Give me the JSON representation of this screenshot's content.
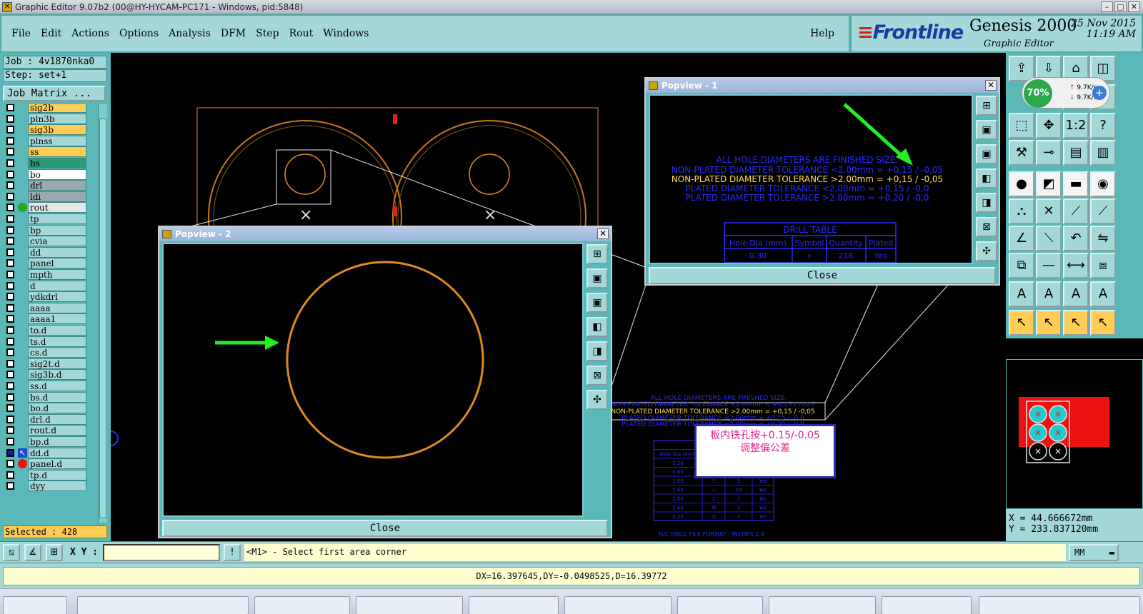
{
  "window": {
    "title": "Graphic Editor 9.07b2 (00@HY-HYCAM-PC171 - Windows, pid:5848)"
  },
  "menu": [
    "File",
    "Edit",
    "Actions",
    "Options",
    "Analysis",
    "DFM",
    "Step",
    "Rout",
    "Windows"
  ],
  "help": "Help",
  "brand": {
    "logo": "Frontline",
    "product": "Genesis 2000",
    "subtitle": "Graphic Editor",
    "date": "25 Nov 2015",
    "time": "11:19 AM"
  },
  "job": {
    "job": "Job : 4v1870nka0",
    "step": "Step: set+1",
    "matrix_button": "Job Matrix ..."
  },
  "layers": [
    {
      "name": "sig2b",
      "bg": "#ffcc55",
      "dot": ""
    },
    {
      "name": "pln3b",
      "bg": "#a4d8d8",
      "dot": ""
    },
    {
      "name": "sig3b",
      "bg": "#ffcc55",
      "dot": ""
    },
    {
      "name": "plnss",
      "bg": "#a4d8d8",
      "dot": ""
    },
    {
      "name": "ss",
      "bg": "#ffcc55",
      "dot": ""
    },
    {
      "name": "bs",
      "bg": "#2a9a7a",
      "dot": ""
    },
    {
      "name": "bo",
      "bg": "#ffffff",
      "dot": ""
    },
    {
      "name": "drl",
      "bg": "#9aa8b0",
      "dot": ""
    },
    {
      "name": "ldi",
      "bg": "#9aa8b0",
      "dot": ""
    },
    {
      "name": "rout",
      "bg": "#e6e6e6",
      "dot": "#22aa22"
    },
    {
      "name": "tp",
      "bg": "#a4d8d8",
      "dot": ""
    },
    {
      "name": "bp",
      "bg": "#a4d8d8",
      "dot": ""
    },
    {
      "name": "cvia",
      "bg": "#a4d8d8",
      "dot": ""
    },
    {
      "name": "dd",
      "bg": "#a4d8d8",
      "dot": ""
    },
    {
      "name": "panel",
      "bg": "#a4d8d8",
      "dot": ""
    },
    {
      "name": "mpth",
      "bg": "#a4d8d8",
      "dot": ""
    },
    {
      "name": "d",
      "bg": "#a4d8d8",
      "dot": ""
    },
    {
      "name": "ydkdrl",
      "bg": "#a4d8d8",
      "dot": ""
    },
    {
      "name": "aaaa",
      "bg": "#a4d8d8",
      "dot": ""
    },
    {
      "name": "aaaa1",
      "bg": "#a4d8d8",
      "dot": ""
    },
    {
      "name": "to.d",
      "bg": "#a4d8d8",
      "dot": ""
    },
    {
      "name": "ts.d",
      "bg": "#a4d8d8",
      "dot": ""
    },
    {
      "name": "cs.d",
      "bg": "#a4d8d8",
      "dot": ""
    },
    {
      "name": "sig2t.d",
      "bg": "#a4d8d8",
      "dot": ""
    },
    {
      "name": "sig3b.d",
      "bg": "#a4d8d8",
      "dot": ""
    },
    {
      "name": "ss.d",
      "bg": "#a4d8d8",
      "dot": ""
    },
    {
      "name": "bs.d",
      "bg": "#a4d8d8",
      "dot": ""
    },
    {
      "name": "bo.d",
      "bg": "#a4d8d8",
      "dot": ""
    },
    {
      "name": "drl.d",
      "bg": "#a4d8d8",
      "dot": ""
    },
    {
      "name": "rout.d",
      "bg": "#a4d8d8",
      "dot": ""
    },
    {
      "name": "bp.d",
      "bg": "#a4d8d8",
      "dot": ""
    },
    {
      "name": "dd.d",
      "bg": "#a4d8d8",
      "dot": "arrow"
    },
    {
      "name": "panel.d",
      "bg": "#a4d8d8",
      "dot": "#ee1111"
    },
    {
      "name": "tp.d",
      "bg": "#a4d8d8",
      "dot": ""
    },
    {
      "name": "dyy",
      "bg": "#a4d8d8",
      "dot": ""
    }
  ],
  "selected": "Selected : 428",
  "popview1": {
    "title": "Popview - 1",
    "close": "Close"
  },
  "popview2": {
    "title": "Popview - 2",
    "close": "Close"
  },
  "notes": {
    "line1": "ALL HOLE DIAMETERS ARE FINISHED SIZE.",
    "line2": "NON-PLATED DIAMETER TOLERANCE <2.00mm = +0,15 / -0,05",
    "line3": "NON-PLATED DIAMETER TOLERANCE >2.00mm = +0,15 / -0,05",
    "line4": "PLATED DIAMETER TOLERANCE <2.00mm = +0,15 / -0,0",
    "line5": "PLATED DIAMETER TOLERANCE >2.00mm = +0,20 / -0,0"
  },
  "drill_table": {
    "title": "DRILL TABLE",
    "headers": [
      "Hole Dia (mm)",
      "Symbol",
      "Quantity",
      "Plated"
    ],
    "rows": [
      [
        "0.30",
        "+",
        "216",
        "Yes"
      ],
      [
        "0.80",
        "X",
        "7",
        "Yes"
      ],
      [
        "1.00",
        "Y",
        "3",
        "Yes"
      ],
      [
        "1.60",
        "+",
        "18",
        "Yes"
      ],
      [
        "2.05",
        "Σ",
        "2",
        "No"
      ],
      [
        "2.60",
        "M",
        "1",
        "Yes"
      ],
      [
        "3.20",
        "⊡",
        "4",
        "Yes"
      ]
    ],
    "footer": "N/C DRILL FILE  FORMAT : INCHES 2.4"
  },
  "annotation": {
    "line1": "板内铣孔按+0.15/-0.05",
    "line2": "调整偏公差"
  },
  "network": {
    "percent": "70%",
    "up": "9.7K/s",
    "down": "9.7K/s"
  },
  "coords": {
    "x": "X  =  44.666672mm",
    "y": "Y  =  233.837120mm"
  },
  "cmd": {
    "xy_label": "X Y :",
    "prompt": "<M1> - Select first area corner",
    "unit": "MM"
  },
  "status": "DX=16.397645,DY=-0.0498525,D=16.39772",
  "colors": {
    "teal_panel": "#5ab8b8",
    "teal_light": "#a4d8d8",
    "highlight": "#ffcc55",
    "outline": "#e08a20",
    "note_blue": "#2a2aff",
    "arrow_green": "#22ee22"
  }
}
